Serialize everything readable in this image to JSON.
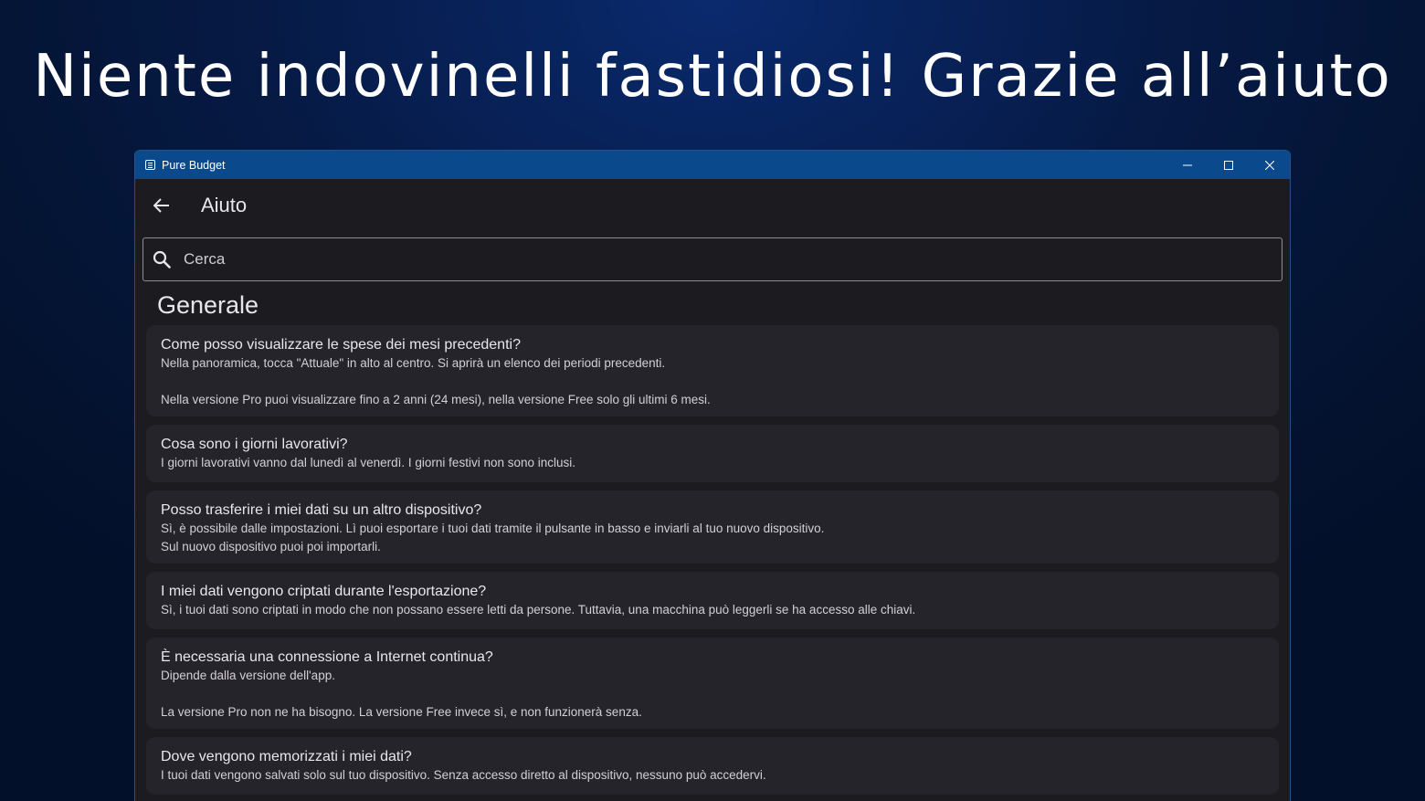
{
  "headline": "Niente indovinelli fastidiosi! Grazie all’aiuto",
  "window": {
    "title": "Pure Budget",
    "app_icon": "calculator-icon",
    "controls": {
      "minimize": "minimize-icon",
      "maximize": "maximize-icon",
      "close": "close-icon"
    }
  },
  "appbar": {
    "back_icon": "arrow-left-icon",
    "title": "Aiuto"
  },
  "search": {
    "placeholder": "Cerca",
    "value": "",
    "icon": "search-icon"
  },
  "section": {
    "title": "Generale"
  },
  "faq": [
    {
      "question": "Come posso visualizzare le spese dei mesi precedenti?",
      "answer": "Nella panoramica, tocca \"Attuale\" in alto al centro. Si aprirà un elenco dei periodi precedenti.\n\nNella versione Pro puoi visualizzare fino a 2 anni (24 mesi), nella versione Free solo gli ultimi 6 mesi."
    },
    {
      "question": "Cosa sono i giorni lavorativi?",
      "answer": "I giorni lavorativi vanno dal lunedì al venerdì. I giorni festivi non sono inclusi."
    },
    {
      "question": "Posso trasferire i miei dati su un altro dispositivo?",
      "answer": "Sì, è possibile dalle impostazioni. Lì puoi esportare i tuoi dati tramite il pulsante in basso e inviarli al tuo nuovo dispositivo.\nSul nuovo dispositivo puoi poi importarli."
    },
    {
      "question": "I miei dati vengono criptati durante l'esportazione?",
      "answer": "Sì, i tuoi dati sono criptati in modo che non possano essere letti da persone. Tuttavia, una macchina può leggerli se ha accesso alle chiavi."
    },
    {
      "question": "È necessaria una connessione a Internet continua?",
      "answer": "Dipende dalla versione dell'app.\n\nLa versione Pro non ne ha bisogno. La versione Free invece sì, e non funzionerà senza."
    },
    {
      "question": "Dove vengono memorizzati i miei dati?",
      "answer": "I tuoi dati vengono salvati solo sul tuo dispositivo. Senza accesso diretto al dispositivo, nessuno può accedervi."
    }
  ]
}
